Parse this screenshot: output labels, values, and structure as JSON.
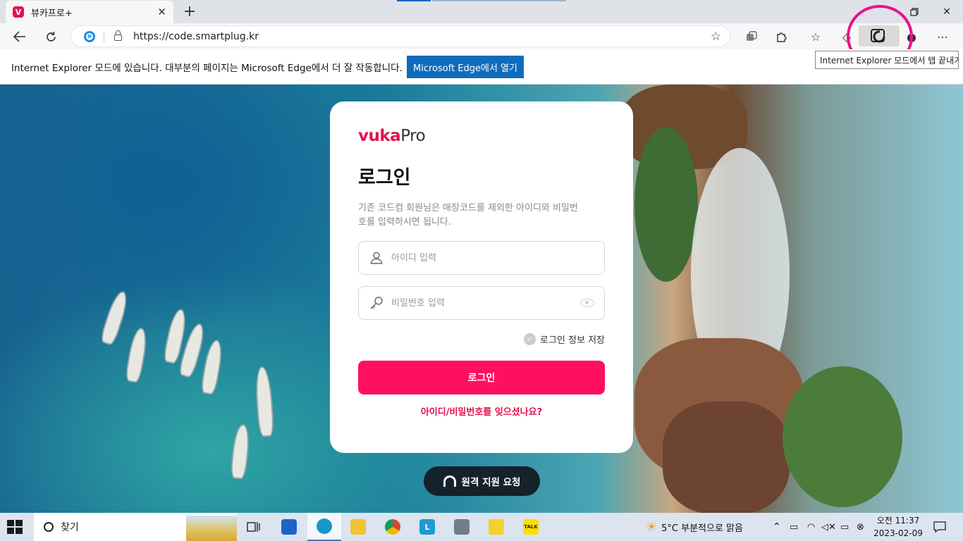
{
  "browser": {
    "tab_title": "뷰카프로+",
    "tab_favicon": "V",
    "new_tab": "+",
    "url": "https://code.smartplug.kr",
    "tooltip": "Internet Explorer 모드에서 탭 끝내기",
    "accent_color": "#0f6cbd"
  },
  "infobar": {
    "message": "Internet Explorer 모드에 있습니다. 대부분의 페이지는 Microsoft Edge에서 더 잘 작동합니다.",
    "open_button": "Microsoft Edge에서 열기"
  },
  "login": {
    "logo_mark": "vuka",
    "logo_suffix": "Pro",
    "title": "로그인",
    "description": "기존 코드컴 회원님은 매장코드를 제외한 아이디와 비밀번호를 입력하시면 됩니다.",
    "id_placeholder": "아이디 입력",
    "password_placeholder": "비밀번호 입력",
    "remember_label": "로그인 정보 저장",
    "submit_label": "로그인",
    "forgot_link": "아이디/비밀번호를 잊으셨나요?",
    "brand_color": "#ff0f5f"
  },
  "remote_support": {
    "label": "원격 지원 요청"
  },
  "taskbar": {
    "search_placeholder": "찾기",
    "weather": "5°C  부분적으로 맑음",
    "time": "오전 11:37",
    "date": "2023-02-09",
    "apps": [
      "task-view",
      "store",
      "edge",
      "file-explorer",
      "chrome",
      "L-app",
      "calculator",
      "sticky-notes",
      "kakaotalk"
    ],
    "kakao_label": "TALK",
    "l_app_label": "L"
  }
}
